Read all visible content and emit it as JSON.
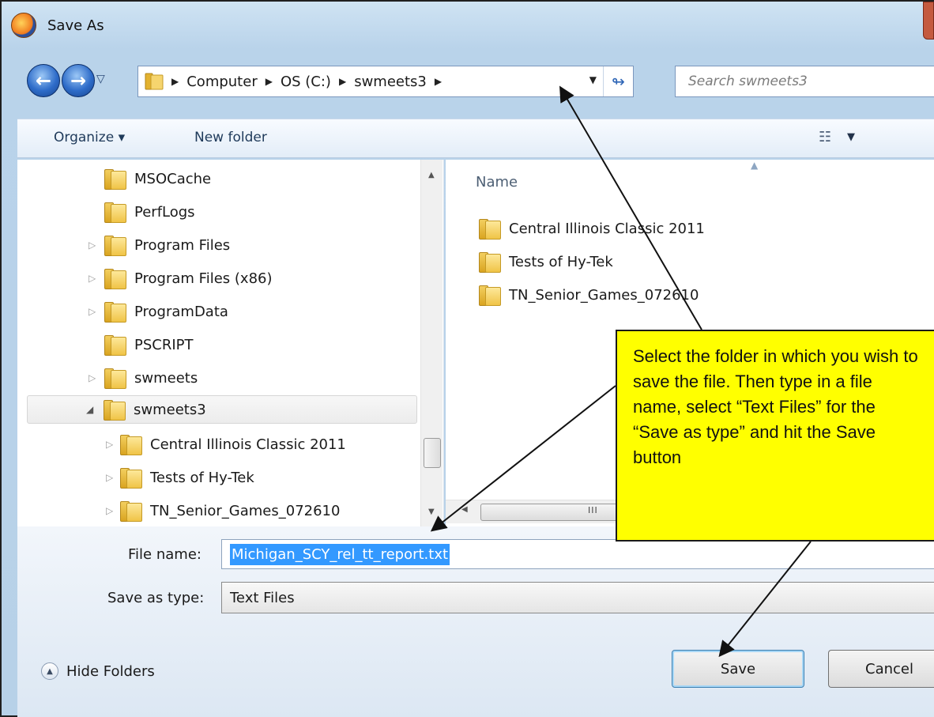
{
  "window": {
    "title": "Save As"
  },
  "nav": {
    "breadcrumbs": [
      "Computer",
      "OS (C:)",
      "swmeets3"
    ],
    "search_placeholder": "Search swmeets3"
  },
  "toolbar": {
    "organize": "Organize ▾",
    "new_folder": "New folder"
  },
  "tree": [
    {
      "label": "MSOCache",
      "expandable": false
    },
    {
      "label": "PerfLogs",
      "expandable": false
    },
    {
      "label": "Program Files",
      "expandable": true
    },
    {
      "label": "Program Files (x86)",
      "expandable": true
    },
    {
      "label": "ProgramData",
      "expandable": true
    },
    {
      "label": "PSCRIPT",
      "expandable": false
    },
    {
      "label": "swmeets",
      "expandable": true
    },
    {
      "label": "swmeets3",
      "expandable": true,
      "expanded": true,
      "selected": true
    },
    {
      "label": "Central Illinois Classic 2011",
      "expandable": true,
      "child": true
    },
    {
      "label": "Tests of Hy-Tek",
      "expandable": true,
      "child": true
    },
    {
      "label": "TN_Senior_Games_072610",
      "expandable": true,
      "child": true
    }
  ],
  "files": {
    "column_name": "Name",
    "items": [
      "Central Illinois Classic 2011",
      "Tests of Hy-Tek",
      "TN_Senior_Games_072610"
    ]
  },
  "form": {
    "file_name_label": "File name:",
    "file_name_value": "Michigan_SCY_rel_tt_report.txt",
    "save_type_label": "Save as type:",
    "save_type_value": "Text Files"
  },
  "footer": {
    "hide_folders": "Hide Folders",
    "save": "Save",
    "cancel": "Cancel"
  },
  "callout": {
    "text": "Select the folder in which you wish to save the file. Then type in a file name, select “Text Files” for the “Save as type”  and hit the Save button"
  },
  "colors": {
    "callout": "#ffff00",
    "selection": "#3399ff"
  }
}
